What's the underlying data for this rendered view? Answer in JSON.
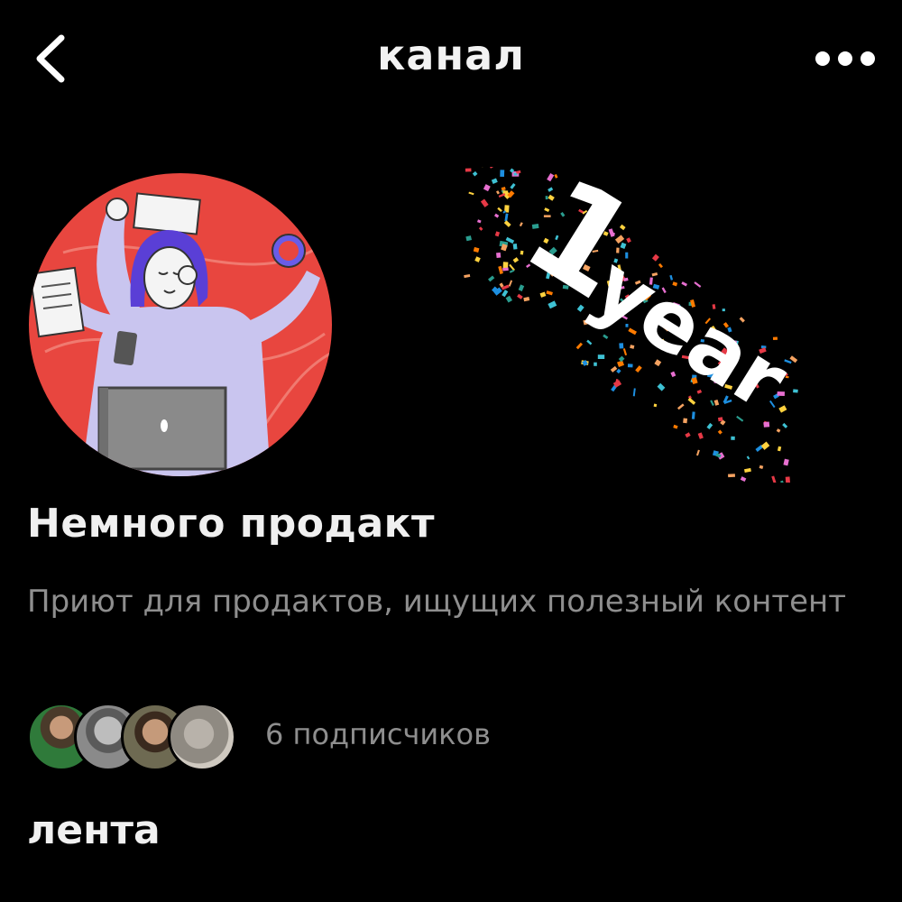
{
  "header": {
    "title": "канал",
    "back_icon": "chevron-left-icon",
    "more_icon": "more-horizontal-icon"
  },
  "channel": {
    "name": "Немного продакт",
    "description": "Приют для продактов, ищущих полезный контент",
    "badge_text_1": "1",
    "badge_text_2": "year"
  },
  "subscribers": {
    "count_label": "6 подписчиков",
    "avatars": [
      "subscriber-1",
      "subscriber-2",
      "subscriber-3",
      "subscriber-4"
    ]
  },
  "feed": {
    "title": "лента"
  },
  "colors": {
    "background": "#000000",
    "avatar_bg": "#e8463f",
    "secondary_text": "#8e8e8e"
  }
}
